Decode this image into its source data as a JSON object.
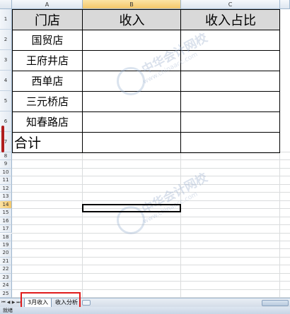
{
  "columns": [
    "A",
    "B",
    "C"
  ],
  "rows": [
    "1",
    "2",
    "3",
    "4",
    "5",
    "6",
    "7",
    "8",
    "9",
    "10",
    "11",
    "12",
    "13",
    "14",
    "15",
    "16",
    "17",
    "18",
    "19",
    "20",
    "21",
    "22",
    "23",
    "24",
    "25"
  ],
  "table": {
    "headers": [
      "门店",
      "收入",
      "收入占比"
    ],
    "stores": [
      "国贸店",
      "王府井店",
      "西单店",
      "三元桥店",
      "知春路店"
    ],
    "total_label": "合计"
  },
  "watermark": {
    "text_cn": "中华会计网校",
    "text_url": "www.chinaacc.com"
  },
  "sheet_tabs": [
    {
      "label": "3月收入",
      "active": true
    },
    {
      "label": "收入分析",
      "active": false
    }
  ],
  "nav_icons": [
    "first-sheet-icon",
    "prev-sheet-icon",
    "next-sheet-icon",
    "last-sheet-icon"
  ],
  "status": {
    "ready": "就绪"
  },
  "colors": {
    "header_fill": "#d9d9d9",
    "annotation_red": "#e01b1b"
  }
}
